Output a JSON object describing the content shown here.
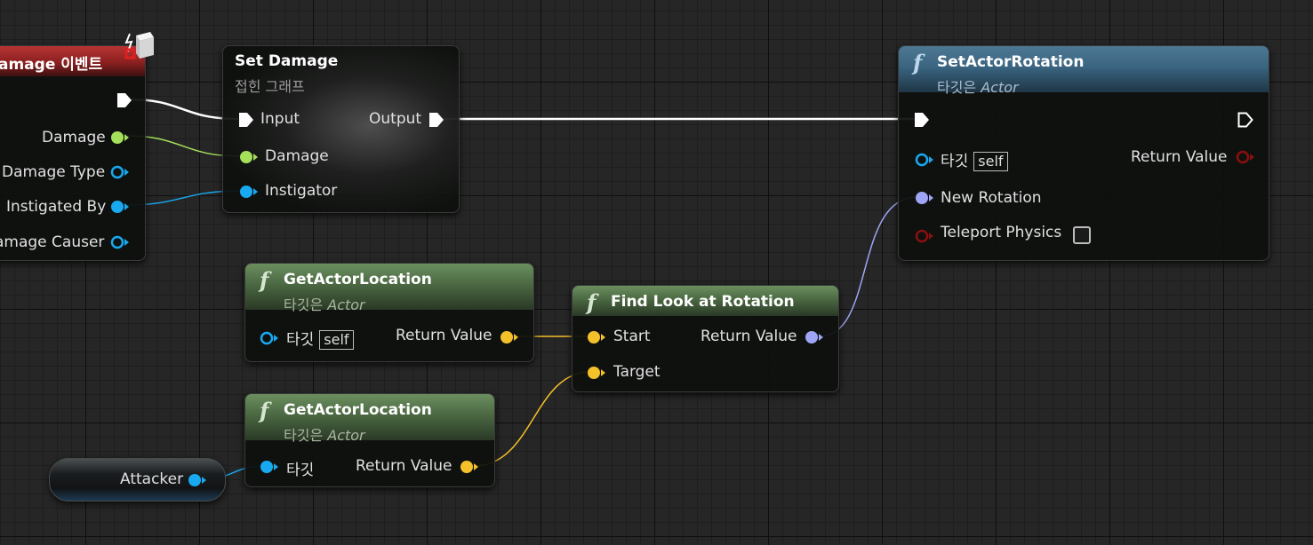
{
  "event_node": {
    "title": "amage 이벤트",
    "pins": {
      "damage": "Damage",
      "damage_type": "Damage Type",
      "instigated_by": "Instigated By",
      "damage_causer": "amage Causer"
    }
  },
  "set_damage": {
    "title": "Set Damage",
    "subtitle": "접힌 그래프",
    "pins": {
      "input": "Input",
      "output": "Output",
      "damage": "Damage",
      "instigator": "Instigator"
    }
  },
  "set_actor_rotation": {
    "title": "SetActorRotation",
    "subtitle_prefix": "타깃은 ",
    "subtitle_type": "Actor",
    "pins": {
      "target": "타깃",
      "self": "self",
      "return_value": "Return Value",
      "new_rotation": "New Rotation",
      "teleport_physics": "Teleport Physics"
    },
    "teleport_checked": false
  },
  "get_actor_location_1": {
    "title": "GetActorLocation",
    "subtitle_prefix": "타깃은 ",
    "subtitle_type": "Actor",
    "pins": {
      "target": "타깃",
      "self": "self",
      "return_value": "Return Value"
    }
  },
  "get_actor_location_2": {
    "title": "GetActorLocation",
    "subtitle_prefix": "타깃은 ",
    "subtitle_type": "Actor",
    "pins": {
      "target": "타깃",
      "return_value": "Return Value"
    }
  },
  "find_look_at_rotation": {
    "title": "Find Look at Rotation",
    "pins": {
      "start": "Start",
      "target": "Target",
      "return_value": "Return Value"
    }
  },
  "attacker_getter": {
    "label": "Attacker"
  },
  "colors": {
    "exec": "#ffffff",
    "float": "#a5e05b",
    "object": "#18a9f0",
    "vector": "#f5c12a",
    "rotator": "#9ea5f5",
    "bool": "#8a0f0f"
  },
  "icons": [
    "function-icon",
    "event-damage-icon",
    "exec-pin-icon",
    "checkbox-icon"
  ]
}
